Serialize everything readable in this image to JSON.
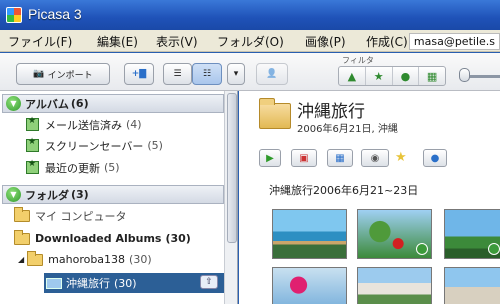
{
  "window": {
    "title": "Picasa 3"
  },
  "menu": [
    "ファイル(F)",
    "編集(E)",
    "表示(V)",
    "フォルダ(O)",
    "画像(P)",
    "作成(C)"
  ],
  "account": "masa@petile.s",
  "toolbar": {
    "import_label": "インポート",
    "filter_label": "フィルタ"
  },
  "left_pane": {
    "albums": {
      "label": "アルバム",
      "count": "(6)"
    },
    "album_items": [
      {
        "label": "メール送信済み",
        "count": "(4)"
      },
      {
        "label": "スクリーンセーバー",
        "count": "(5)"
      },
      {
        "label": "最近の更新",
        "count": "(5)"
      }
    ],
    "folders": {
      "label": "フォルダ",
      "count": "(3)"
    },
    "folder_items": [
      {
        "label": "マイ コンピュータ",
        "count": ""
      },
      {
        "label": "Downloaded Albums",
        "count": "(30)"
      },
      {
        "label": "mahoroba138",
        "count": "(30)"
      },
      {
        "label": "沖縄旅行",
        "count": "(30)"
      }
    ]
  },
  "right_pane": {
    "album_title": "沖縄旅行",
    "album_subtitle": "2006年6月21日, 沖縄",
    "date_header": "沖縄旅行2006年6月21~23日"
  }
}
